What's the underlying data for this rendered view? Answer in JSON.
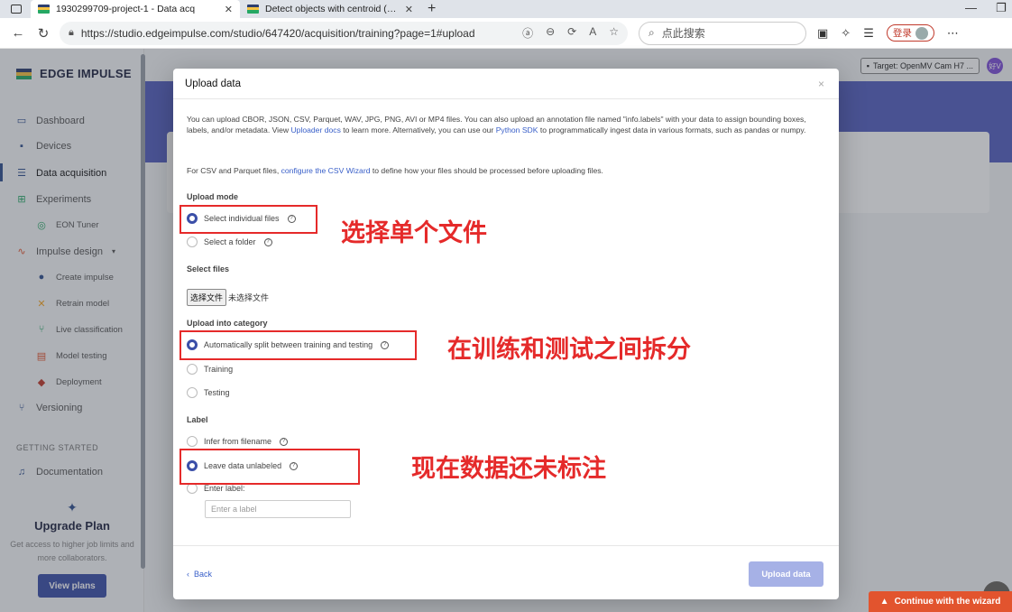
{
  "browser": {
    "tabs": [
      {
        "title": "1930299709-project-1 - Data acq",
        "active": true
      },
      {
        "title": "Detect objects with centroid (FO",
        "active": false
      }
    ],
    "url": "https://studio.edgeimpulse.com/studio/647420/acquisition/training?page=1#upload",
    "search_placeholder": "点此搜索",
    "login_label": "登录"
  },
  "app": {
    "brand": "EDGE IMPULSE",
    "target_label": "Target: OpenMV Cam H7 ...",
    "user_initials": "好V",
    "sidebar": {
      "items": [
        {
          "label": "Dashboard",
          "icon": "monitor-icon"
        },
        {
          "label": "Devices",
          "icon": "chip-icon"
        },
        {
          "label": "Data acquisition",
          "icon": "database-icon"
        },
        {
          "label": "Experiments",
          "icon": "grid-icon"
        },
        {
          "label": "EON Tuner",
          "icon": "target-icon"
        },
        {
          "label": "Impulse design",
          "icon": "pulse-icon"
        },
        {
          "label": "Create impulse",
          "icon": "dot-icon"
        },
        {
          "label": "Retrain model",
          "icon": "shuffle-icon"
        },
        {
          "label": "Live classification",
          "icon": "branch-icon"
        },
        {
          "label": "Model testing",
          "icon": "clipboard-icon"
        },
        {
          "label": "Deployment",
          "icon": "package-icon"
        },
        {
          "label": "Versioning",
          "icon": "git-icon"
        }
      ],
      "getting_started_heading": "GETTING STARTED",
      "documentation": "Documentation",
      "upgrade_title": "Upgrade Plan",
      "upgrade_desc": "Get access to higher job limits and more collaborators.",
      "view_plans": "View plans"
    },
    "wizard_button": "Continue with the wizard"
  },
  "modal": {
    "title": "Upload data",
    "intro_1": "You can upload CBOR, JSON, CSV, Parquet, WAV, JPG, PNG, AVI or MP4 files. You can also upload an annotation file named \"info.labels\" with your data to assign bounding boxes, labels, and/or metadata. View ",
    "uploader_docs_link": "Uploader docs",
    "intro_2": " to learn more. Alternatively, you can use our ",
    "python_sdk_link": "Python SDK",
    "intro_3": " to programmatically ingest data in various formats, such as pandas or numpy.",
    "csv_1": "For CSV and Parquet files, ",
    "csv_link": "configure the CSV Wizard",
    "csv_2": " to define how your files should be processed before uploading files.",
    "upload_mode_label": "Upload mode",
    "upload_mode_options": [
      {
        "label": "Select individual files",
        "selected": true,
        "help": true
      },
      {
        "label": "Select a folder",
        "selected": false,
        "help": true
      }
    ],
    "select_files_label": "Select files",
    "file_button": "选择文件",
    "file_status": "未选择文件",
    "category_label": "Upload into category",
    "category_options": [
      {
        "label": "Automatically split between training and testing",
        "selected": true,
        "help": true
      },
      {
        "label": "Training",
        "selected": false,
        "help": false
      },
      {
        "label": "Testing",
        "selected": false,
        "help": false
      }
    ],
    "label_label": "Label",
    "label_options": [
      {
        "label": "Infer from filename",
        "selected": false,
        "help": true
      },
      {
        "label": "Leave data unlabeled",
        "selected": true,
        "help": true
      },
      {
        "label": "Enter label:",
        "selected": false,
        "help": false
      }
    ],
    "label_placeholder": "Enter a label",
    "back": "Back",
    "upload_button": "Upload data",
    "close_glyph": "×"
  },
  "annotations": {
    "select_files": "选择单个文件",
    "split": "在训练和测试之间拆分",
    "unlabeled": "现在数据还未标注"
  },
  "colors": {
    "annotation_red": "#e52a2a",
    "accent": "#3b4fa8",
    "wizard_orange": "#e2542e"
  }
}
